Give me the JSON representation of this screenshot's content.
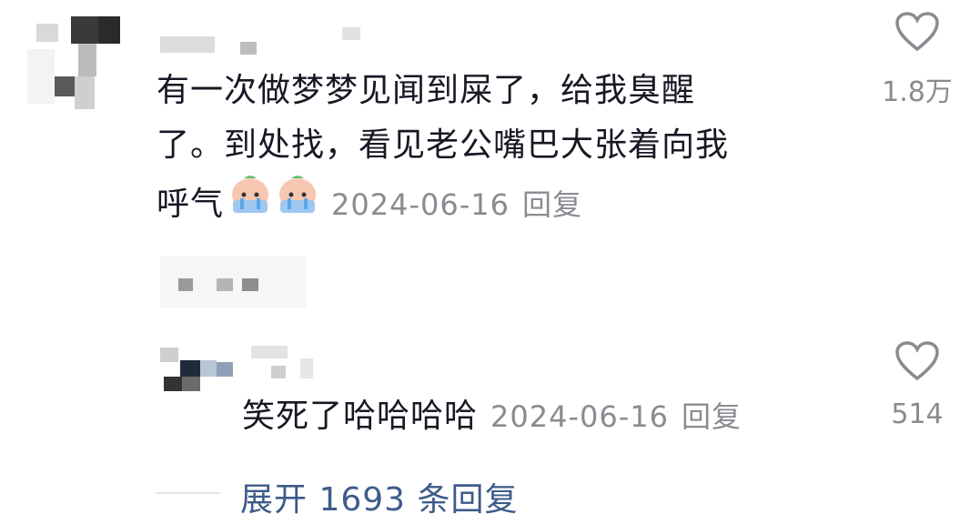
{
  "comments": [
    {
      "text_lines": [
        "有一次做梦梦见闻到屎了，给我臭醒",
        "了。到处找，看见老公嘴巴大张着向我",
        "呼气"
      ],
      "emoji": "crying-face-emoji",
      "date": "2024-06-16",
      "reply_label": "回复",
      "likes": "1.8万"
    }
  ],
  "reply": {
    "text": "笑死了哈哈哈哈",
    "date": "2024-06-16",
    "reply_label": "回复",
    "likes": "514"
  },
  "expand": {
    "label": "展开 1693 条回复"
  },
  "colors": {
    "text": "#161823",
    "meta": "#8a8b91",
    "link": "#3e5b89"
  }
}
